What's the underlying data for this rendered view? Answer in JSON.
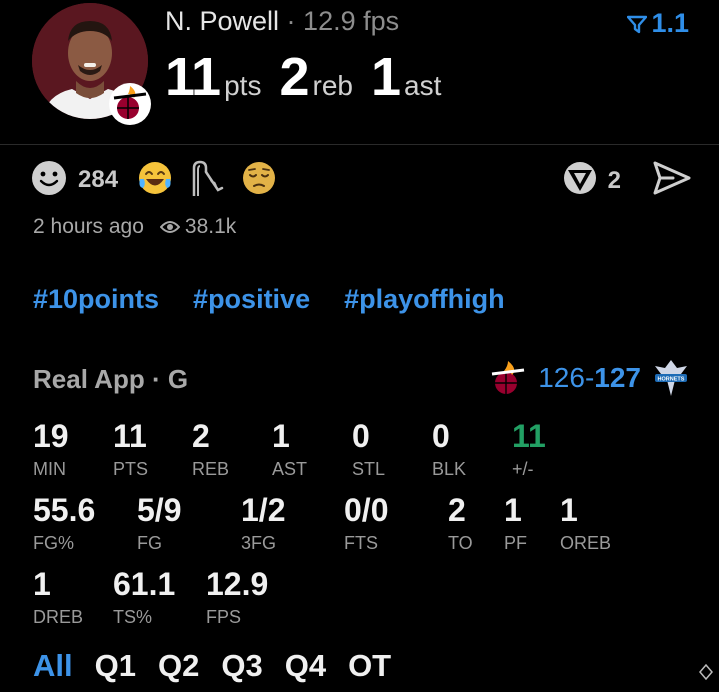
{
  "header": {
    "player_name": "N. Powell",
    "separator": " · ",
    "fps_text": "12.9 fps",
    "filter_badge": "1.1",
    "stats": [
      {
        "value": "11",
        "unit": "pts"
      },
      {
        "value": "2",
        "unit": "reb"
      },
      {
        "value": "1",
        "unit": "ast"
      }
    ]
  },
  "reactions": {
    "smile_count": "284",
    "comment_count": "2"
  },
  "meta": {
    "posted": "2 hours ago",
    "views": "38.1k"
  },
  "hashtags": [
    "#10points",
    "#positive",
    "#playoffhigh"
  ],
  "game": {
    "source": "Real App · G",
    "score_left": "126",
    "score_dash": "-",
    "score_right": "127",
    "opponent_logo_text": "HORNETS"
  },
  "boxscore": [
    {
      "value": "19",
      "label": "MIN"
    },
    {
      "value": "11",
      "label": "PTS"
    },
    {
      "value": "2",
      "label": "REB"
    },
    {
      "value": "1",
      "label": "AST"
    },
    {
      "value": "0",
      "label": "STL"
    },
    {
      "value": "0",
      "label": "BLK"
    },
    {
      "value": "11",
      "label": "+/-"
    },
    {
      "value": "55.6",
      "label": "FG%"
    },
    {
      "value": "5/9",
      "label": "FG"
    },
    {
      "value": "1/2",
      "label": "3FG"
    },
    {
      "value": "0/0",
      "label": "FTS"
    },
    {
      "value": "2",
      "label": "TO"
    },
    {
      "value": "1",
      "label": "PF"
    },
    {
      "value": "1",
      "label": "OREB"
    },
    {
      "value": "1",
      "label": "DREB"
    },
    {
      "value": "61.1",
      "label": "TS%"
    },
    {
      "value": "12.9",
      "label": "FPS"
    }
  ],
  "periods": [
    "All",
    "Q1",
    "Q2",
    "Q3",
    "Q4",
    "OT"
  ],
  "colors": {
    "accent": "#3d93e8",
    "positive": "#22a064",
    "team_red": "#98002e"
  }
}
